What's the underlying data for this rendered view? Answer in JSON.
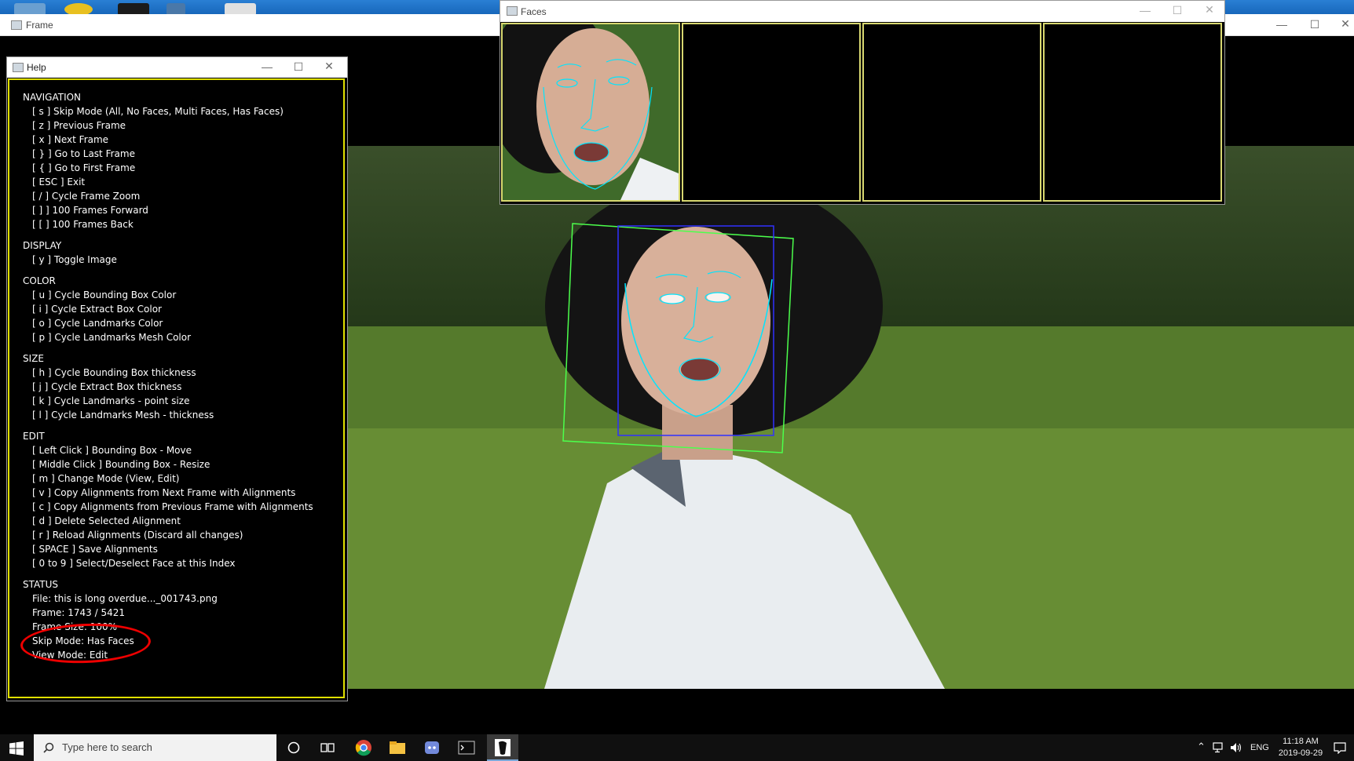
{
  "frame_window": {
    "title": "Frame"
  },
  "help_window": {
    "title": "Help",
    "sections": [
      {
        "heading": "NAVIGATION",
        "lines": [
          "[ s ] Skip Mode (All, No Faces, Multi Faces, Has Faces)",
          "[ z ] Previous Frame",
          "[ x ] Next Frame",
          "[ } ] Go to Last Frame",
          "[ { ] Go to First Frame",
          "[ ESC ] Exit",
          "[ / ] Cycle Frame Zoom",
          "[ ] ] 100 Frames Forward",
          "[ [ ] 100 Frames Back"
        ]
      },
      {
        "heading": "DISPLAY",
        "lines": [
          "[ y ] Toggle Image"
        ]
      },
      {
        "heading": "COLOR",
        "lines": [
          "[ u ] Cycle Bounding Box Color",
          "[ i ] Cycle Extract Box Color",
          "[ o ] Cycle Landmarks Color",
          "[ p ] Cycle Landmarks Mesh Color"
        ]
      },
      {
        "heading": "SIZE",
        "lines": [
          "[ h ] Cycle Bounding Box thickness",
          "[ j ] Cycle Extract Box thickness",
          "[ k ] Cycle Landmarks - point size",
          "[ l ] Cycle Landmarks Mesh - thickness"
        ]
      },
      {
        "heading": "EDIT",
        "lines": [
          "[ Left Click ] Bounding Box - Move",
          "[ Middle Click ] Bounding Box - Resize",
          "[ m ] Change Mode (View, Edit)",
          "[ v ] Copy Alignments from Next Frame with Alignments",
          "[ c ] Copy Alignments from Previous Frame with Alignments",
          "[ d ] Delete Selected Alignment",
          "[ r ] Reload Alignments (Discard all changes)",
          "[ SPACE ] Save Alignments",
          "[ 0 to 9 ] Select/Deselect Face at this Index"
        ]
      }
    ],
    "status": {
      "heading": "STATUS",
      "file": "File: this is long overdue..._001743.png",
      "frame": "Frame: 1743 / 5421",
      "frame_size": "Frame Size: 100%",
      "skip_mode": "Skip Mode: Has Faces",
      "view_mode": "View Mode: Edit"
    }
  },
  "faces_window": {
    "title": "Faces"
  },
  "taskbar": {
    "search_placeholder": "Type here to search",
    "tray_lang": "ENG",
    "time": "11:18 AM",
    "date": "2019-09-29"
  },
  "colors": {
    "help_border": "#e0e000",
    "extract_box": "#4cff4c",
    "bounding_box": "#3030ff",
    "landmarks": "#00e5ff",
    "annotation": "#e00000"
  }
}
